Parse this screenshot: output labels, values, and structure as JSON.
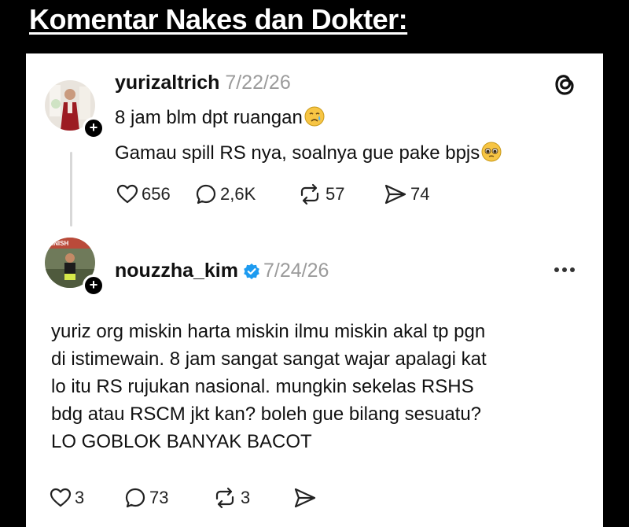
{
  "heading": "Komentar Nakes dan Dokter:",
  "post": {
    "username": "yurizaltrich",
    "date": "7/22/26",
    "line1": "8 jam blm dpt ruangan",
    "line1_emoji": "crying-face",
    "line2": "Gamau spill RS nya, soalnya gue pake bpjs",
    "line2_emoji": "pleading-face",
    "likes": "656",
    "replies": "2,6K",
    "reposts": "57",
    "shares": "74"
  },
  "reply": {
    "username": "nouzzha_kim",
    "date": "7/24/26",
    "verified": true,
    "avatar_text": "FINISH",
    "lines": [
      "yuriz org miskin harta miskin ilmu miskin akal tp pgn",
      "di istimewain. 8 jam sangat sangat wajar apalagi kat",
      "lo itu RS rujukan nasional. mungkin sekelas RSHS",
      "bdg atau RSCM jkt kan? boleh gue bilang sesuatu?",
      "LO GOBLOK BANYAK BACOT"
    ],
    "likes": "3",
    "replies": "73",
    "reposts": "3"
  },
  "icons": {
    "app": "threads-logo-icon",
    "like": "heart-icon",
    "reply": "comment-icon",
    "repost": "repost-icon",
    "share": "send-icon",
    "menu": "more-icon"
  },
  "colors": {
    "background": "#000000",
    "card": "#ffffff",
    "text": "#111111",
    "muted": "#9b9b9b",
    "verified": "#1d9bf0"
  }
}
